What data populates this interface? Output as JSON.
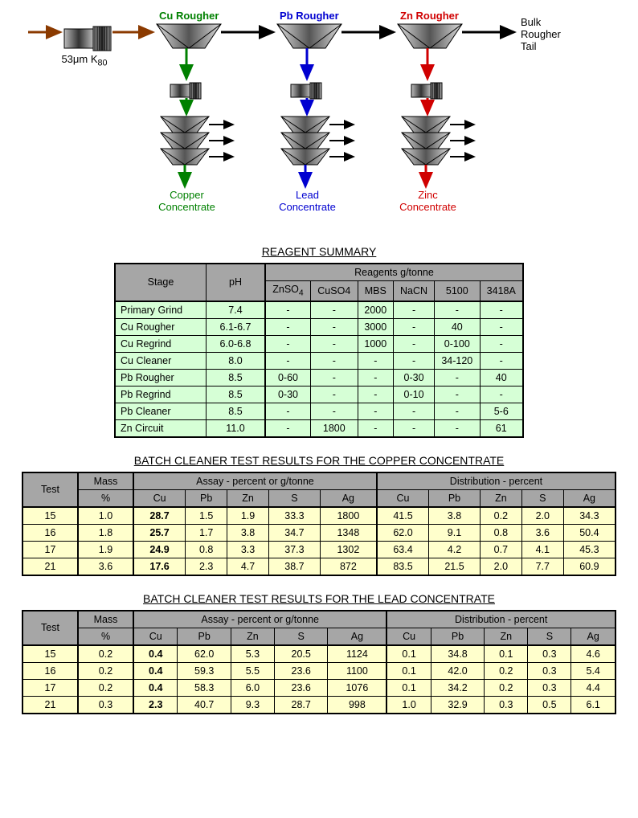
{
  "flowsheet": {
    "feed_label": "53μm K",
    "feed_sub": "80",
    "cu_rougher": "Cu Rougher",
    "pb_rougher": "Pb Rougher",
    "zn_rougher": "Zn Rougher",
    "tail_label1": "Bulk",
    "tail_label2": "Rougher",
    "tail_label3": "Tail",
    "cu_conc1": "Copper",
    "cu_conc2": "Concentrate",
    "pb_conc1": "Lead",
    "pb_conc2": "Concentrate",
    "zn_conc1": "Zinc",
    "zn_conc2": "Concentrate"
  },
  "reagent": {
    "title": "REAGENT SUMMARY",
    "headers": {
      "stage": "Stage",
      "ph": "pH",
      "reagents": "Reagents g/tonne",
      "cols": [
        "ZnSO",
        "CuSO4",
        "MBS",
        "NaCN",
        "5100",
        "3418A"
      ],
      "znso4_sub": "4"
    },
    "rows": [
      {
        "stage": "Primary Grind",
        "ph": "7.4",
        "v": [
          "-",
          "-",
          "2000",
          "-",
          "-",
          "-"
        ]
      },
      {
        "stage": "Cu Rougher",
        "ph": "6.1-6.7",
        "v": [
          "-",
          "-",
          "3000",
          "-",
          "40",
          "-"
        ]
      },
      {
        "stage": "Cu Regrind",
        "ph": "6.0-6.8",
        "v": [
          "-",
          "-",
          "1000",
          "-",
          "0-100",
          "-"
        ]
      },
      {
        "stage": "Cu Cleaner",
        "ph": "8.0",
        "v": [
          "-",
          "-",
          "-",
          "-",
          "34-120",
          "-"
        ]
      },
      {
        "stage": "Pb Rougher",
        "ph": "8.5",
        "v": [
          "0-60",
          "-",
          "-",
          "0-30",
          "-",
          "40"
        ]
      },
      {
        "stage": "Pb Regrind",
        "ph": "8.5",
        "v": [
          "0-30",
          "-",
          "-",
          "0-10",
          "-",
          "-"
        ]
      },
      {
        "stage": "Pb Cleaner",
        "ph": "8.5",
        "v": [
          "-",
          "-",
          "-",
          "-",
          "-",
          "5-6"
        ]
      },
      {
        "stage": "Zn Circuit",
        "ph": "11.0",
        "v": [
          "-",
          "1800",
          "-",
          "-",
          "-",
          "61"
        ]
      }
    ]
  },
  "copper_results": {
    "title": "BATCH CLEANER TEST RESULTS FOR THE COPPER CONCENTRATE",
    "rows": [
      {
        "test": "15",
        "mass": "1.0",
        "assay": [
          "28.7",
          "1.5",
          "1.9",
          "33.3",
          "1800"
        ],
        "dist": [
          "41.5",
          "3.8",
          "0.2",
          "2.0",
          "34.3"
        ]
      },
      {
        "test": "16",
        "mass": "1.8",
        "assay": [
          "25.7",
          "1.7",
          "3.8",
          "34.7",
          "1348"
        ],
        "dist": [
          "62.0",
          "9.1",
          "0.8",
          "3.6",
          "50.4"
        ]
      },
      {
        "test": "17",
        "mass": "1.9",
        "assay": [
          "24.9",
          "0.8",
          "3.3",
          "37.3",
          "1302"
        ],
        "dist": [
          "63.4",
          "4.2",
          "0.7",
          "4.1",
          "45.3"
        ]
      },
      {
        "test": "21",
        "mass": "3.6",
        "assay": [
          "17.6",
          "2.3",
          "4.7",
          "38.7",
          "872"
        ],
        "dist": [
          "83.5",
          "21.5",
          "2.0",
          "7.7",
          "60.9"
        ]
      }
    ]
  },
  "lead_results": {
    "title": "BATCH CLEANER TEST RESULTS FOR THE LEAD CONCENTRATE",
    "rows": [
      {
        "test": "15",
        "mass": "0.2",
        "assay": [
          "0.4",
          "62.0",
          "5.3",
          "20.5",
          "1124"
        ],
        "dist": [
          "0.1",
          "34.8",
          "0.1",
          "0.3",
          "4.6"
        ]
      },
      {
        "test": "16",
        "mass": "0.2",
        "assay": [
          "0.4",
          "59.3",
          "5.5",
          "23.6",
          "1100"
        ],
        "dist": [
          "0.1",
          "42.0",
          "0.2",
          "0.3",
          "5.4"
        ]
      },
      {
        "test": "17",
        "mass": "0.2",
        "assay": [
          "0.4",
          "58.3",
          "6.0",
          "23.6",
          "1076"
        ],
        "dist": [
          "0.1",
          "34.2",
          "0.2",
          "0.3",
          "4.4"
        ]
      },
      {
        "test": "21",
        "mass": "0.3",
        "assay": [
          "2.3",
          "40.7",
          "9.3",
          "28.7",
          "998"
        ],
        "dist": [
          "1.0",
          "32.9",
          "0.3",
          "0.5",
          "6.1"
        ]
      }
    ]
  },
  "results_headers": {
    "test": "Test",
    "mass": "Mass",
    "mass_unit": "%",
    "assay": "Assay  - percent or g/tonne",
    "dist": "Distribution - percent",
    "cols": [
      "Cu",
      "Pb",
      "Zn",
      "S",
      "Ag"
    ]
  }
}
